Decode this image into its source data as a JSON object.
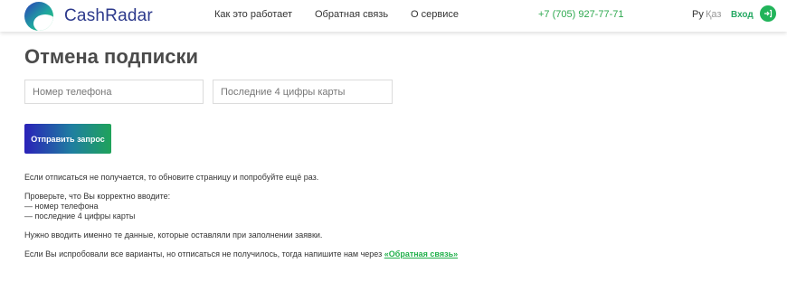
{
  "header": {
    "logo_text": "CashRadar",
    "nav": [
      "Как это работает",
      "Обратная связь",
      "О сервисе"
    ],
    "phone": "+7 (705) 927-77-71",
    "lang_ru": "Ру",
    "lang_kz": "Қаз",
    "login_label": "Вход"
  },
  "main": {
    "title": "Отмена подписки",
    "phone_placeholder": "Номер телефона",
    "card_placeholder": "Последние 4 цифры карты",
    "submit_label": "Отправить запрос",
    "hint_reload": "Если отписаться не получается, то обновите страницу и попробуйте ещё раз.",
    "hint_check_title": "Проверьте, что Вы корректно вводите:",
    "hint_check_phone": "— номер телефона",
    "hint_check_card": "— последние 4 цифры карты",
    "hint_same_data": "Нужно вводить именно те данные, которые оставляли при заполнении заявки.",
    "hint_contact": "Если Вы испробовали все варианты, но отписаться не получилось, тогда напишите нам через ",
    "feedback_link": "«Обратная связь»"
  },
  "colors": {
    "accent_green": "#22b04b",
    "brand_blue": "#2d3a8c",
    "button_gradient_start": "#2a21b8",
    "button_gradient_end": "#1fa35a"
  },
  "icons": {
    "logo": "radar-logo-icon",
    "login": "login-arrow-icon"
  }
}
